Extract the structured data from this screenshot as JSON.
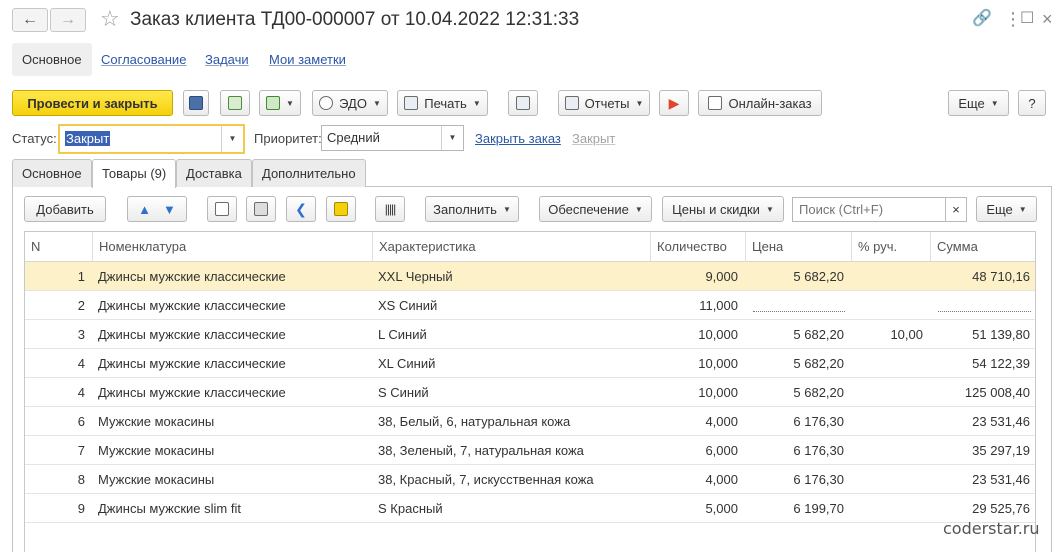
{
  "window": {
    "title": "Заказ клиента ТД00-000007 от 10.04.2022 12:31:33",
    "nav_back_icon": "arrow-left-icon",
    "nav_forward_icon": "arrow-right-icon",
    "favorite_icon": "star-icon",
    "right_icons": [
      "link-icon",
      "more-vertical-icon",
      "maximize-icon",
      "close-icon"
    ]
  },
  "section_tabs": [
    {
      "label": "Основное",
      "active": true
    },
    {
      "label": "Согласование",
      "active": false
    },
    {
      "label": "Задачи",
      "active": false
    },
    {
      "label": "Мои заметки",
      "active": false
    }
  ],
  "toolbar": {
    "post_close_label": "Провести и закрыть",
    "edo_label": "ЭДО",
    "print_label": "Печать",
    "reports_label": "Отчеты",
    "online_order_label": "Онлайн-заказ",
    "more_label": "Еще",
    "help_label": "?"
  },
  "status": {
    "label": "Статус:",
    "value": "Закрыт",
    "priority_label": "Приоритет:",
    "priority_value": "Средний",
    "close_order_link": "Закрыть заказ",
    "closed_link": "Закрыт"
  },
  "form_tabs": [
    {
      "label": "Основное",
      "active": false
    },
    {
      "label": "Товары (9)",
      "active": true
    },
    {
      "label": "Доставка",
      "active": false
    },
    {
      "label": "Дополнительно",
      "active": false
    }
  ],
  "table_toolbar": {
    "add_label": "Добавить",
    "fill_label": "Заполнить",
    "supply_label": "Обеспечение",
    "prices_label": "Цены и скидки",
    "search_placeholder": "Поиск (Ctrl+F)",
    "clear_label": "×",
    "more_label": "Еще"
  },
  "table": {
    "columns": [
      "N",
      "Номенклатура",
      "Характеристика",
      "Количество",
      "Цена",
      "% руч.",
      "Сумма"
    ],
    "rows": [
      {
        "n": "1",
        "item": "Джинсы мужские классические",
        "char": "XXL Черный",
        "qty": "9,000",
        "price": "5 682,20",
        "pct": "",
        "sum": "48 710,16",
        "selected": true
      },
      {
        "n": "2",
        "item": "Джинсы мужские классические",
        "char": "XS Синий",
        "qty": "11,000",
        "price": "",
        "pct": "",
        "sum": "",
        "selected": false
      },
      {
        "n": "3",
        "item": "Джинсы мужские классические",
        "char": "L Синий",
        "qty": "10,000",
        "price": "5 682,20",
        "pct": "10,00",
        "sum": "51 139,80",
        "selected": false
      },
      {
        "n": "4",
        "item": "Джинсы мужские классические",
        "char": "XL Синий",
        "qty": "10,000",
        "price": "5 682,20",
        "pct": "",
        "sum": "54 122,39",
        "selected": false
      },
      {
        "n": "4",
        "item": "Джинсы мужские классические",
        "char": "S Синий",
        "qty": "10,000",
        "price": "5 682,20",
        "pct": "",
        "sum": "125 008,40",
        "selected": false
      },
      {
        "n": "6",
        "item": "Мужские мокасины",
        "char": "38, Белый, 6, натуральная кожа",
        "qty": "4,000",
        "price": "6 176,30",
        "pct": "",
        "sum": "23 531,46",
        "selected": false
      },
      {
        "n": "7",
        "item": "Мужские мокасины",
        "char": "38, Зеленый, 7, натуральная кожа",
        "qty": "6,000",
        "price": "6 176,30",
        "pct": "",
        "sum": "35 297,19",
        "selected": false
      },
      {
        "n": "8",
        "item": "Мужские мокасины",
        "char": "38, Красный, 7, искусственная кожа",
        "qty": "4,000",
        "price": "6 176,30",
        "pct": "",
        "sum": "23 531,46",
        "selected": false
      },
      {
        "n": "9",
        "item": "Джинсы мужские slim fit",
        "char": "S Красный",
        "qty": "5,000",
        "price": "6 199,70",
        "pct": "",
        "sum": "29 525,76",
        "selected": false
      }
    ]
  },
  "watermark": "coderstar.ru",
  "colors": {
    "primary_button": "#f5d10b",
    "link": "#2b57a8",
    "selected_row": "#fcf1c8",
    "focus_border": "#f2c94c"
  }
}
